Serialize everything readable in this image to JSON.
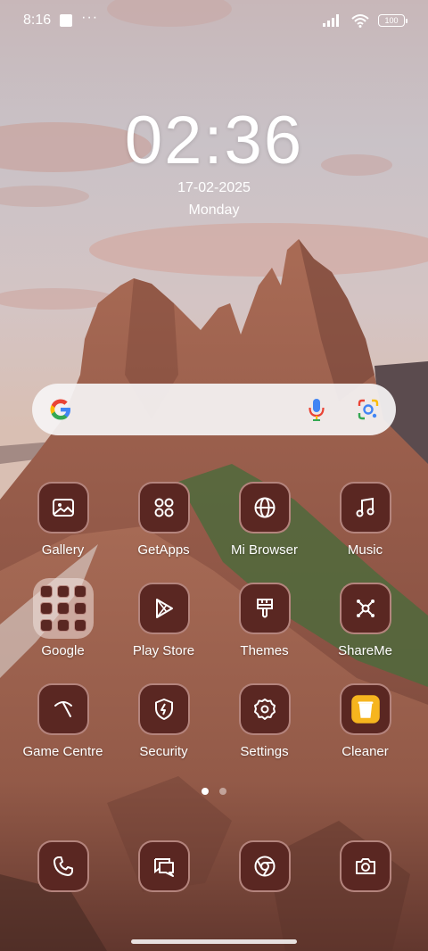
{
  "status_bar": {
    "time": "8:16",
    "notification_icons": [
      "square-notification-icon",
      "more-dots-icon"
    ],
    "system_icons": [
      "signal-icon",
      "wifi-icon",
      "battery-icon"
    ],
    "battery_level": "100"
  },
  "clock": {
    "time": "02:36",
    "date": "17-02-2025",
    "weekday": "Monday"
  },
  "search": {
    "icons": [
      "google-logo-icon",
      "microphone-icon",
      "google-lens-icon"
    ]
  },
  "apps": [
    {
      "label": "Gallery",
      "icon": "image-icon"
    },
    {
      "label": "GetApps",
      "icon": "four-circles-icon"
    },
    {
      "label": "Mi Browser",
      "icon": "globe-icon"
    },
    {
      "label": "Music",
      "icon": "music-note-icon"
    },
    {
      "label": "Google",
      "icon": "folder-icon"
    },
    {
      "label": "Play Store",
      "icon": "play-triangle-icon"
    },
    {
      "label": "Themes",
      "icon": "paint-brush-icon"
    },
    {
      "label": "ShareMe",
      "icon": "share-nodes-icon"
    },
    {
      "label": "Game Centre",
      "icon": "game-centre-icon"
    },
    {
      "label": "Security",
      "icon": "shield-bolt-icon"
    },
    {
      "label": "Settings",
      "icon": "gear-icon"
    },
    {
      "label": "Cleaner",
      "icon": "trash-can-icon"
    }
  ],
  "pager": {
    "pages": 2,
    "active": 1
  },
  "dock": [
    {
      "icon": "phone-icon"
    },
    {
      "icon": "messages-icon"
    },
    {
      "icon": "chrome-icon"
    },
    {
      "icon": "camera-icon"
    }
  ],
  "colors": {
    "icon_bg": "#5a2722",
    "icon_border": "#f0c8be",
    "cleaner_accent": "#f6b51e"
  }
}
